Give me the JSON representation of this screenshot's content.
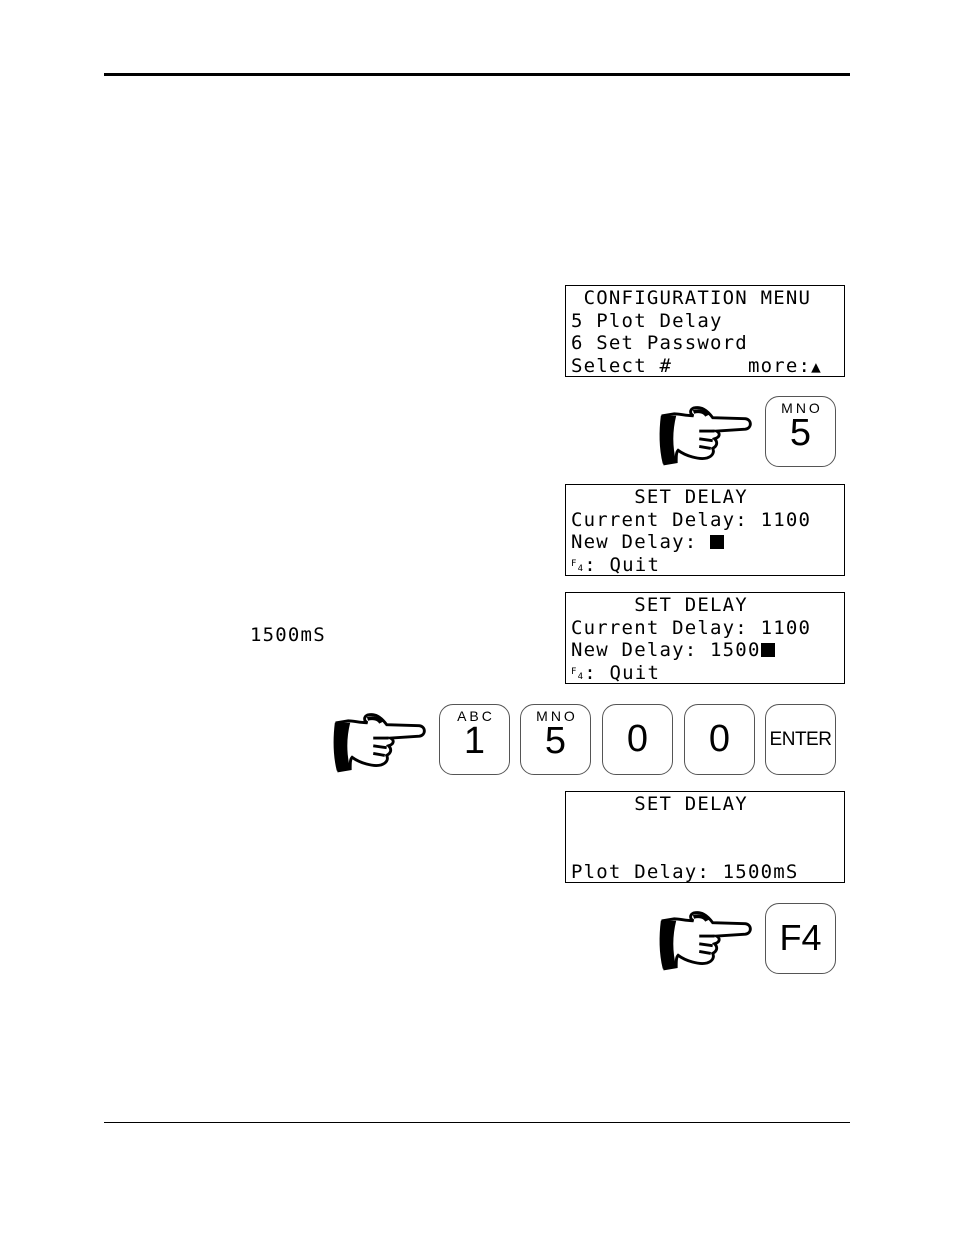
{
  "page": {
    "margin_note": "1500mS"
  },
  "screens": {
    "config_menu": {
      "title": " CONFIGURATION MENU",
      "line1": "5 Plot Delay",
      "line2": "6 Set Password",
      "line3_left": "Select #      more:",
      "line3_icon": "▲"
    },
    "set_delay_empty": {
      "title": "     SET DELAY",
      "current": "Current Delay: 1100",
      "new_label": "New Delay: ",
      "new_value": "",
      "fkey": "F",
      "fkey_sub": "4",
      "quit": ": Quit"
    },
    "set_delay_typed": {
      "title": "     SET DELAY",
      "current": "Current Delay: 1100",
      "new_label": "New Delay: ",
      "new_value": "1500",
      "fkey": "F",
      "fkey_sub": "4",
      "quit": ": Quit"
    },
    "set_delay_done": {
      "title": "     SET DELAY",
      "line1": "",
      "line2": "",
      "result": "Plot Delay: 1500mS"
    }
  },
  "keys": {
    "step1": {
      "letters": "MNO",
      "digit": "5"
    },
    "step2": [
      {
        "letters": "ABC",
        "digit": "1"
      },
      {
        "letters": "MNO",
        "digit": "5"
      },
      {
        "letters": "",
        "digit": "0"
      },
      {
        "letters": "",
        "digit": "0"
      },
      {
        "word": "ENTER"
      }
    ],
    "step3": {
      "word": "F4"
    }
  },
  "icons": {
    "hand": "pointing-hand-icon"
  }
}
